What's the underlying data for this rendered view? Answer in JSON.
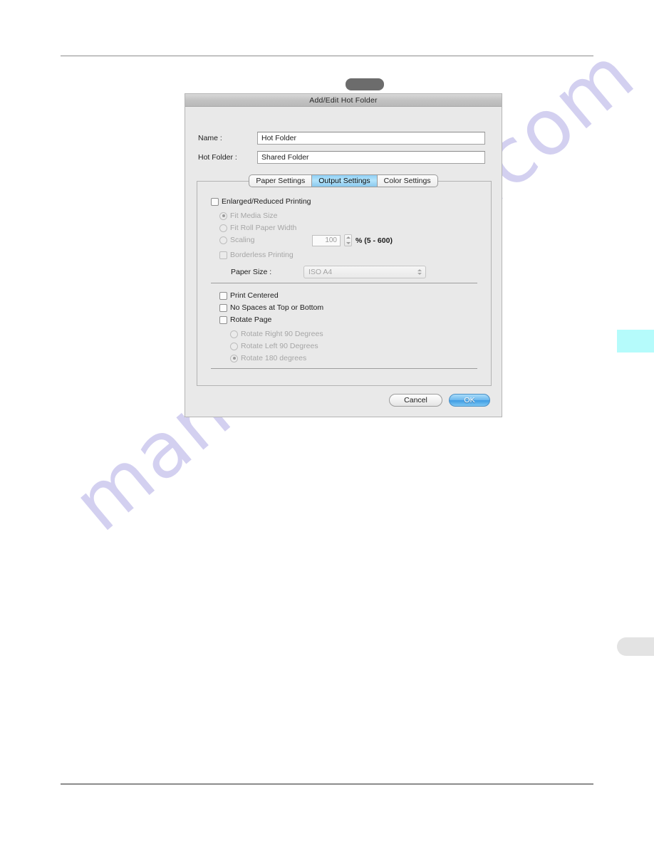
{
  "page": {
    "watermark_text": "manualshive.com",
    "watermark_color": "#b9b4e8",
    "edge_tab_cyan_color": "#b5fbfb",
    "edge_tab_grey_color": "#e3e3e3"
  },
  "toolbar": {
    "pill_color": "#6c6c6c"
  },
  "dialog": {
    "title": "Add/Edit Hot Folder",
    "fields": [
      {
        "label": "Name :",
        "value": "Hot Folder"
      },
      {
        "label": "Hot Folder :",
        "value": "Shared Folder"
      }
    ],
    "tabs": [
      {
        "label": "Paper Settings",
        "active": false
      },
      {
        "label": "Output Settings",
        "active": true
      },
      {
        "label": "Color Settings",
        "active": false
      }
    ],
    "accent_color": "#8fd0f5",
    "output_settings": {
      "enlarged_reduced": {
        "label": "Enlarged/Reduced Printing",
        "checked": false
      },
      "scale_options": [
        {
          "label": "Fit Media Size",
          "selected": true
        },
        {
          "label": "Fit Roll Paper Width",
          "selected": false
        },
        {
          "label": "Scaling",
          "selected": false
        }
      ],
      "scaling_value": "100",
      "scaling_note": "% (5 - 600)",
      "borderless": {
        "label": "Borderless Printing",
        "checked": false
      },
      "paper_size": {
        "label": "Paper Size :",
        "value": "ISO A4"
      },
      "layout_options": [
        {
          "label": "Print Centered",
          "checked": false
        },
        {
          "label": "No Spaces at Top or Bottom",
          "checked": false
        },
        {
          "label": "Rotate Page",
          "checked": false
        }
      ],
      "rotate_options": [
        {
          "label": "Rotate Right 90 Degrees",
          "selected": false
        },
        {
          "label": "Rotate Left 90 Degrees",
          "selected": false
        },
        {
          "label": "Rotate 180 degrees",
          "selected": true
        }
      ]
    },
    "buttons": {
      "cancel": "Cancel",
      "ok": "OK"
    }
  }
}
